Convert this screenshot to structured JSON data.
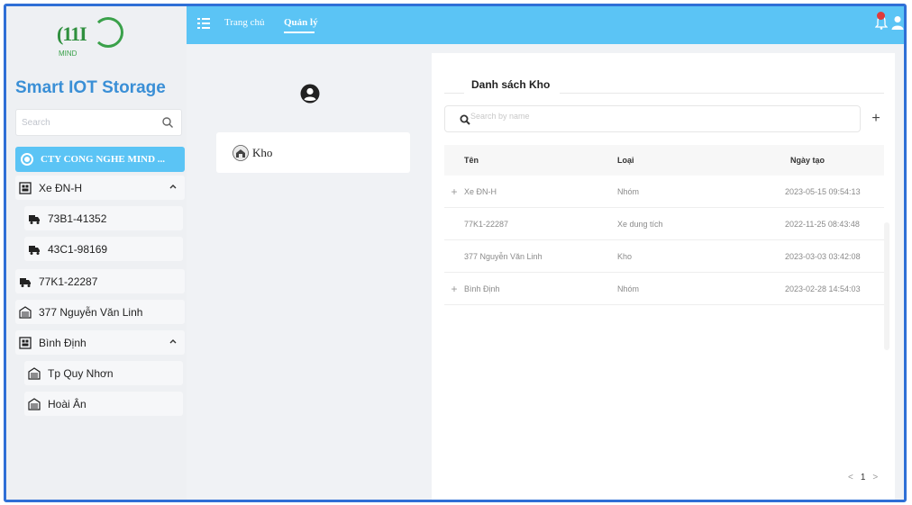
{
  "brand": {
    "logo_text": "(11I",
    "logo_sub": "MIND",
    "app_title": "Smart IOT Storage"
  },
  "sidebar": {
    "search_placeholder": "Search",
    "company": "CTY CONG NGHE MIND ...",
    "items": [
      {
        "label": "Xe ĐN-H",
        "level": 0,
        "icon": "group-icon",
        "expanded": true
      },
      {
        "label": "73B1-41352",
        "level": 1,
        "icon": "truck-icon"
      },
      {
        "label": "43C1-98169",
        "level": 1,
        "icon": "truck-icon"
      },
      {
        "label": "77K1-22287",
        "level": 0,
        "icon": "truck-icon"
      },
      {
        "label": "377 Nguyễn Văn Linh",
        "level": 0,
        "icon": "warehouse-icon"
      },
      {
        "label": "Bình Định",
        "level": 0,
        "icon": "group-icon",
        "expanded": true
      },
      {
        "label": "Tp Quy Nhơn",
        "level": 1,
        "icon": "warehouse-icon"
      },
      {
        "label": "Hoài Ân",
        "level": 1,
        "icon": "warehouse-icon"
      }
    ]
  },
  "topbar": {
    "nav_home": "Trang chủ",
    "nav_manage": "Quản lý",
    "accent": "#5bc4f5"
  },
  "middle": {
    "card_label": "Kho"
  },
  "list": {
    "title": "Danh sách Kho",
    "search_placeholder": "Search by name",
    "add_label": "+",
    "columns": [
      "Tên",
      "Loại",
      "Ngày tạo"
    ],
    "rows": [
      {
        "expand": "+",
        "name": "Xe ĐN-H",
        "type": "Nhóm",
        "date": "2023-05-15 09:54:13"
      },
      {
        "expand": "",
        "name": "77K1-22287",
        "type": "Xe dung tích",
        "date": "2022-11-25 08:43:48"
      },
      {
        "expand": "",
        "name": "377 Nguyễn Văn Linh",
        "type": "Kho",
        "date": "2023-03-03 03:42:08"
      },
      {
        "expand": "+",
        "name": "Bình Định",
        "type": "Nhóm",
        "date": "2023-02-28 14:54:03"
      }
    ],
    "pager": {
      "prev": "<",
      "page": "1",
      "next": ">"
    }
  }
}
